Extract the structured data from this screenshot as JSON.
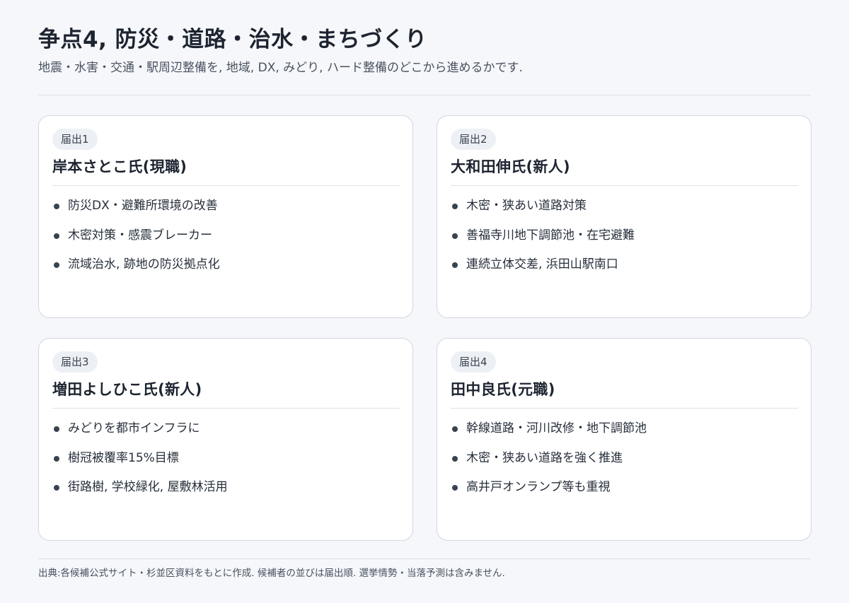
{
  "header": {
    "title": "争点4, 防災・道路・治水・まちづくり",
    "subtitle": "地震・水害・交通・駅周辺整備を, 地域, DX, みどり, ハード整備のどこから進めるかです."
  },
  "cards": [
    {
      "badge": "届出1",
      "name": "岸本さとこ氏(現職)",
      "items": [
        "防災DX・避難所環境の改善",
        "木密対策・感震ブレーカー",
        "流域治水, 跡地の防災拠点化"
      ]
    },
    {
      "badge": "届出2",
      "name": "大和田伸氏(新人)",
      "items": [
        "木密・狭あい道路対策",
        "善福寺川地下調節池・在宅避難",
        "連続立体交差, 浜田山駅南口"
      ]
    },
    {
      "badge": "届出3",
      "name": "増田よしひこ氏(新人)",
      "items": [
        "みどりを都市インフラに",
        "樹冠被覆率15%目標",
        "街路樹, 学校緑化, 屋敷林活用"
      ]
    },
    {
      "badge": "届出4",
      "name": "田中良氏(元職)",
      "items": [
        "幹線道路・河川改修・地下調節池",
        "木密・狭あい道路を強く推進",
        "高井戸オンランプ等も重視"
      ]
    }
  ],
  "footer": {
    "note": "出典:各候補公式サイト・杉並区資料をもとに作成. 候補者の並びは届出順. 選挙情勢・当落予測は含みません."
  }
}
